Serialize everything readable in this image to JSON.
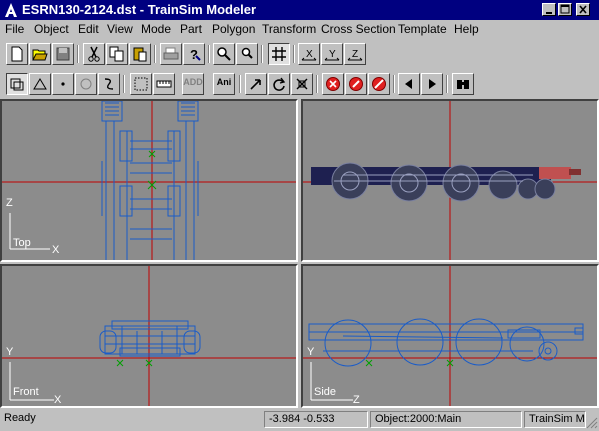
{
  "window": {
    "title": "ESRN130-2124.dst - TrainSim Modeler"
  },
  "menu": [
    "File",
    "Object",
    "Edit",
    "View",
    "Mode",
    "Part",
    "Polygon",
    "Transform",
    "Cross Section",
    "Template",
    "Help"
  ],
  "toolbar2": {
    "ani_label": "Ani",
    "add_label": "ADD"
  },
  "viewports": {
    "top": {
      "label": "Top",
      "axis_v": "Z",
      "axis_h": "X"
    },
    "front": {
      "label": "Front",
      "axis_v": "Y",
      "axis_h": "X"
    },
    "side": {
      "label": "Side",
      "axis_v": "Y",
      "axis_h": "Z"
    }
  },
  "status": {
    "ready": "Ready",
    "coords": "-3.984   -0.533",
    "object": "Object:2000:Main",
    "app": "TrainSim M"
  },
  "colors": {
    "viewport_bg": "#8c8c8c",
    "wire": "#1a5cc8",
    "axis": "#c00000",
    "origin": "#00a000",
    "title_bg": "#000080"
  }
}
